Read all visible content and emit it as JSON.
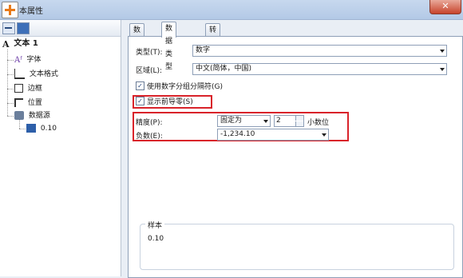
{
  "window": {
    "title": "文本属性",
    "title_visible": "本属性",
    "close_label": "✕"
  },
  "tree": {
    "root": "文本 1",
    "items": [
      {
        "label": "字体",
        "icon": "font-icon"
      },
      {
        "label": "文本格式",
        "icon": "text-format-icon"
      },
      {
        "label": "边框",
        "icon": "border-icon"
      },
      {
        "label": "位置",
        "icon": "position-icon"
      },
      {
        "label": "数据源",
        "icon": "datasource-icon"
      },
      {
        "label": "0.10",
        "icon": "value-icon"
      }
    ]
  },
  "tabs": [
    "数据源",
    "数据类型",
    "转换"
  ],
  "active_tab": "数据类型",
  "form": {
    "type_label": "类型(T):",
    "type_value": "数字",
    "region_label": "区域(L):",
    "region_value": "中文(简体，中国)",
    "group_sep_label": "使用数字分组分隔符(G)",
    "group_sep_checked": true,
    "leading_zero_label": "显示前导零(S)",
    "leading_zero_checked": true,
    "precision_label": "精度(P):",
    "precision_mode": "固定为",
    "precision_digits": "2",
    "precision_unit": "小数位",
    "negative_label": "负数(E):",
    "negative_value": "-1,234.10"
  },
  "sample": {
    "label": "样本",
    "value": "0.10"
  },
  "colors": {
    "highlight": "#d9232a",
    "accent": "#e87a1a"
  }
}
